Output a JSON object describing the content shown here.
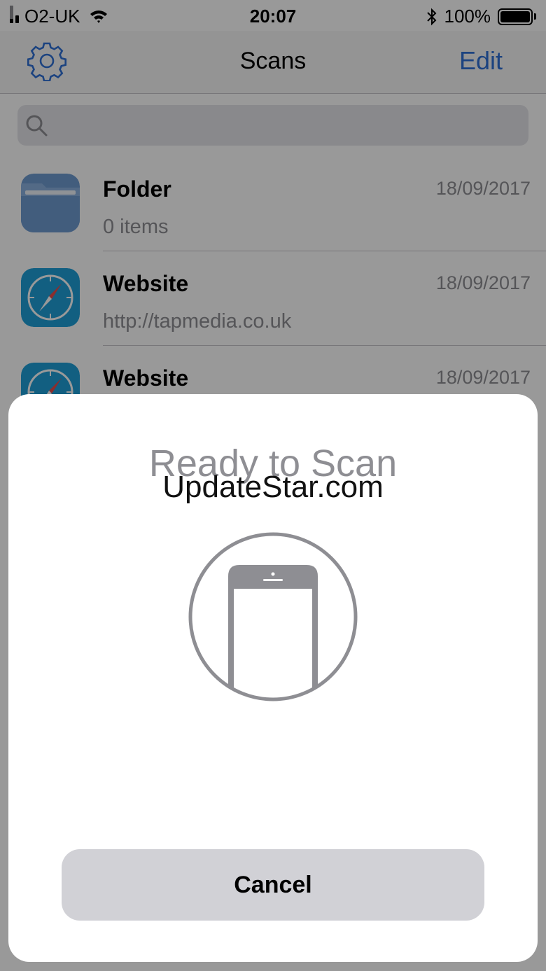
{
  "status_bar": {
    "carrier": "O2-UK",
    "time": "20:07",
    "battery_percent": "100%",
    "signal_bars_filled": 2,
    "signal_bars_total": 4,
    "icons": [
      "signal-icon",
      "wifi-icon",
      "bluetooth-icon",
      "battery-icon"
    ]
  },
  "nav": {
    "title": "Scans",
    "edit_label": "Edit",
    "settings_icon": "gear-icon"
  },
  "search": {
    "placeholder": "",
    "value": "",
    "icon": "search-icon"
  },
  "list": {
    "items": [
      {
        "name": "Folder",
        "date": "18/09/2017",
        "detail": "0 items",
        "icon": "folder-icon"
      },
      {
        "name": "Website",
        "date": "18/09/2017",
        "detail": "http://tapmedia.co.uk",
        "icon": "compass-icon"
      },
      {
        "name": "Website",
        "date": "18/09/2017",
        "detail": "",
        "icon": "compass-icon"
      }
    ]
  },
  "sheet": {
    "title": "Ready to Scan",
    "watermark": "UpdateStar.com",
    "illustration": "phone-scan-icon",
    "cancel_label": "Cancel"
  },
  "colors": {
    "accent": "#2f71d6",
    "secondary_text": "#8e8e93",
    "folder": "#6e9bd1",
    "compass": "#1e9fd8",
    "cancel_button": "#d1d1d6"
  }
}
